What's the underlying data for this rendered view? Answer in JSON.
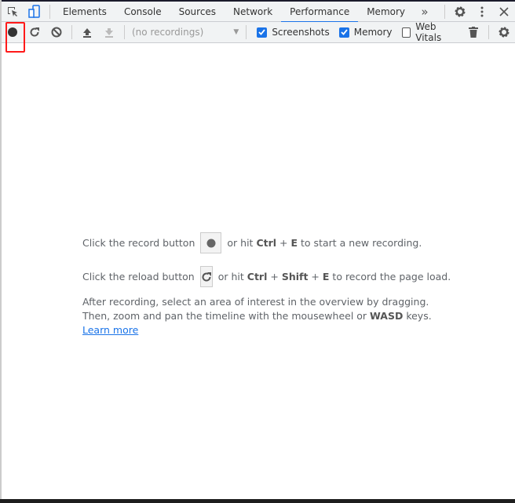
{
  "tabs": [
    {
      "label": "Elements"
    },
    {
      "label": "Console"
    },
    {
      "label": "Sources"
    },
    {
      "label": "Network"
    },
    {
      "label": "Performance",
      "active": true
    },
    {
      "label": "Memory"
    }
  ],
  "toolbar": {
    "recordings_placeholder": "(no recordings)",
    "screenshots_label": "Screenshots",
    "screenshots_checked": true,
    "memory_label": "Memory",
    "memory_checked": true,
    "webvitals_label": "Web Vitals",
    "webvitals_checked": false
  },
  "landing": {
    "l1a": "Click the record button",
    "l1b": "or hit",
    "l1k1": "Ctrl",
    "plus": "+",
    "l1k2": "E",
    "l1c": "to start a new recording.",
    "l2a": "Click the reload button",
    "l2b": "or hit",
    "l2k1": "Ctrl",
    "l2k2": "Shift",
    "l2k3": "E",
    "l2c": "to record the page load.",
    "l3a": "After recording, select an area of interest in the overview by dragging. Then, zoom and pan the timeline with the mousewheel or",
    "l3k": "WASD",
    "l3b": "keys.",
    "learn_more": "Learn more"
  },
  "colors": {
    "accent": "#1a73e8",
    "highlight": "#ff1a1a"
  }
}
